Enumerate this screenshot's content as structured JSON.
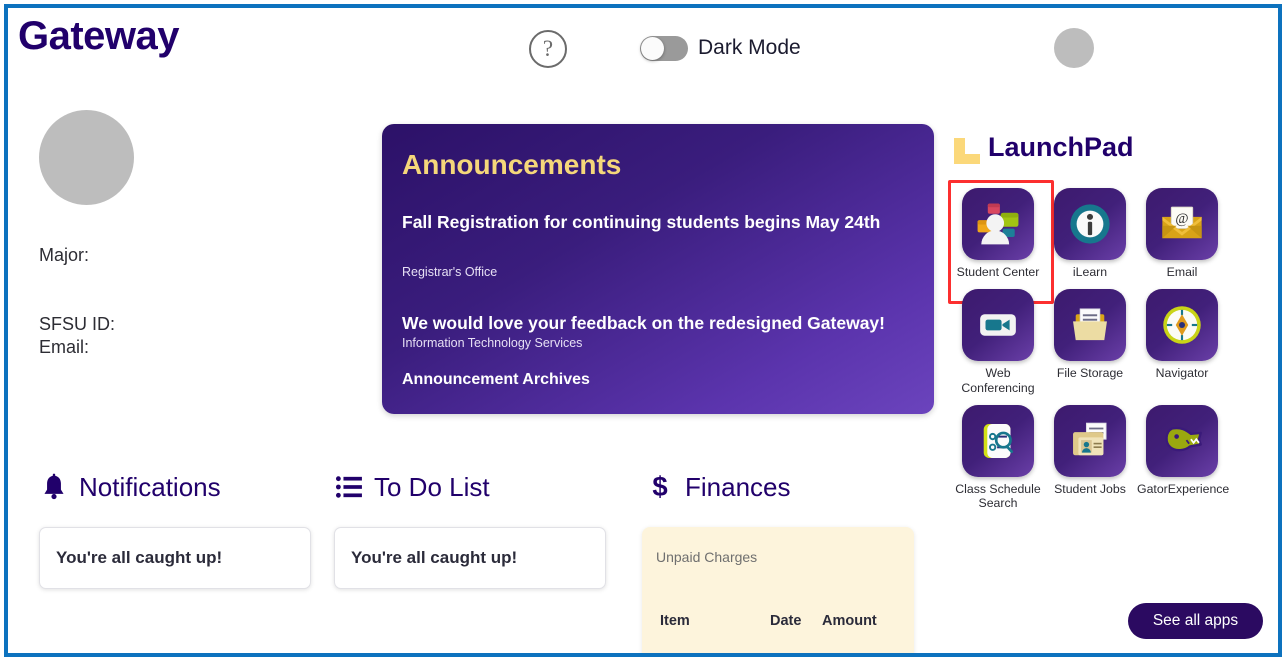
{
  "header": {
    "brand": "Gateway",
    "help_icon": "help-circle-icon",
    "dark_mode_label": "Dark Mode",
    "dark_mode_on": false,
    "avatar": "user-avatar"
  },
  "profile": {
    "major_label": "Major:",
    "sfsu_id_label": "SFSU ID:",
    "email_label": "Email:"
  },
  "announcements": {
    "heading": "Announcements",
    "items": [
      {
        "title": "Fall Registration for continuing students begins May 24th",
        "source": "Registrar's Office"
      },
      {
        "title": "We would love your feedback on the redesigned Gateway!",
        "source": "Information Technology Services"
      }
    ],
    "archives_link": "Announcement Archives"
  },
  "launchpad": {
    "title": "LaunchPad",
    "logo_icon": "launchpad-corner-icon",
    "see_all_label": "See all apps",
    "selected_app": "Student Center",
    "apps": [
      {
        "label": "Student Center",
        "icon": "student-center-icon",
        "selected": true
      },
      {
        "label": "iLearn",
        "icon": "ilearn-info-icon",
        "selected": false
      },
      {
        "label": "Email",
        "icon": "email-envelope-icon",
        "selected": false
      },
      {
        "label": "Web Conferencing",
        "icon": "video-camera-icon",
        "selected": false
      },
      {
        "label": "File Storage",
        "icon": "folder-document-icon",
        "selected": false
      },
      {
        "label": "Navigator",
        "icon": "compass-icon",
        "selected": false
      },
      {
        "label": "Class Schedule Search",
        "icon": "list-search-icon",
        "selected": false
      },
      {
        "label": "Student Jobs",
        "icon": "id-card-folder-icon",
        "selected": false
      },
      {
        "label": "GatorExperience",
        "icon": "gator-mascot-icon",
        "selected": false
      }
    ]
  },
  "widgets": {
    "notifications": {
      "title": "Notifications",
      "icon": "bell-icon",
      "empty_message": "You're all caught up!"
    },
    "todo": {
      "title": "To Do List",
      "icon": "list-icon",
      "empty_message": "You're all caught up!"
    },
    "finances": {
      "title": "Finances",
      "icon": "dollar-icon",
      "subtitle": "Unpaid Charges",
      "columns": [
        "Item",
        "Date",
        "Amount"
      ]
    }
  },
  "colors": {
    "frame_blue": "#0d72be",
    "brand_purple": "#21006b",
    "accent_gold": "#f5d77a",
    "highlight_red": "#fc2f2f",
    "finance_card": "#fdf4dc"
  }
}
